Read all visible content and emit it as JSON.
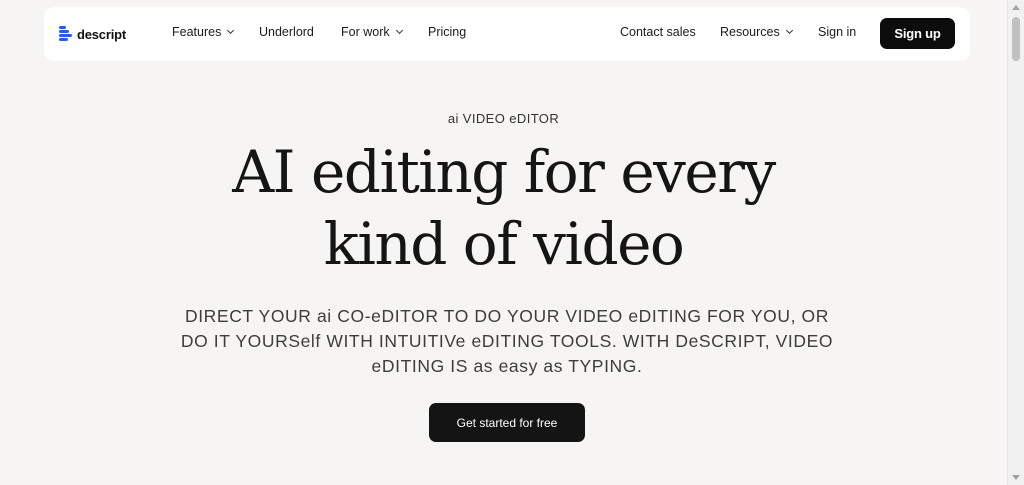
{
  "brand": {
    "name": "descript",
    "accent_color": "#1f5fe6"
  },
  "nav": {
    "items": [
      {
        "label": "Features",
        "has_dropdown": true
      },
      {
        "label": "Underlord",
        "has_dropdown": false
      },
      {
        "label": "For work",
        "has_dropdown": true
      },
      {
        "label": "Pricing",
        "has_dropdown": false
      }
    ],
    "right_items": [
      {
        "label": "Contact sales",
        "has_dropdown": false
      },
      {
        "label": "Resources",
        "has_dropdown": true
      },
      {
        "label": "Sign in",
        "has_dropdown": false
      }
    ],
    "signup_label": "Sign up"
  },
  "hero": {
    "eyebrow": "ai VIDEO eDITOR",
    "headline_line1": "AI editing for every",
    "headline_line2": "kind of video",
    "subtitle": "DIRECT YOUR ai CO-eDITOR TO DO YOUR VIDEO eDITING FOR YOU, OR DO IT YOURSelf WITH INTUITIVe eDITING TOOLS. WITH DeSCRIPT, VIDEO eDITING IS as easy as TYPING.",
    "cta_label": "Get started for free"
  },
  "colors": {
    "background": "#f6f5f3",
    "navbar": "#ffffff",
    "button_dark": "#0c0c0c"
  }
}
